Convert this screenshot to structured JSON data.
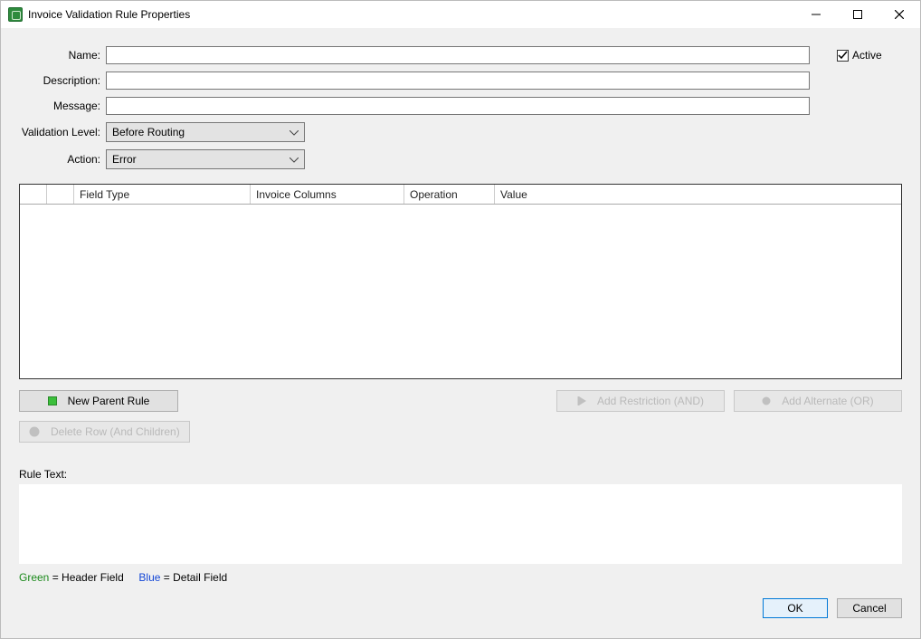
{
  "window": {
    "title": "Invoice Validation Rule Properties"
  },
  "labels": {
    "name": "Name:",
    "description": "Description:",
    "message": "Message:",
    "validation_level": "Validation Level:",
    "action": "Action:",
    "active": "Active",
    "rule_text": "Rule Text:"
  },
  "fields": {
    "name": "",
    "description": "",
    "message": "",
    "validation_level": "Before Routing",
    "action": "Error",
    "active_checked": true
  },
  "grid": {
    "columns": [
      "",
      "",
      "Field Type",
      "Invoice Columns",
      "Operation",
      "Value"
    ]
  },
  "buttons": {
    "new_parent_rule": "New Parent Rule",
    "delete_row": "Delete Row (And Children)",
    "add_restriction": "Add Restriction (AND)",
    "add_alternate": "Add Alternate (OR)",
    "ok": "OK",
    "cancel": "Cancel"
  },
  "legend": {
    "green_word": "Green",
    "green_desc": "  = Header Field",
    "blue_word": "Blue",
    "blue_desc": "  = Detail Field"
  }
}
